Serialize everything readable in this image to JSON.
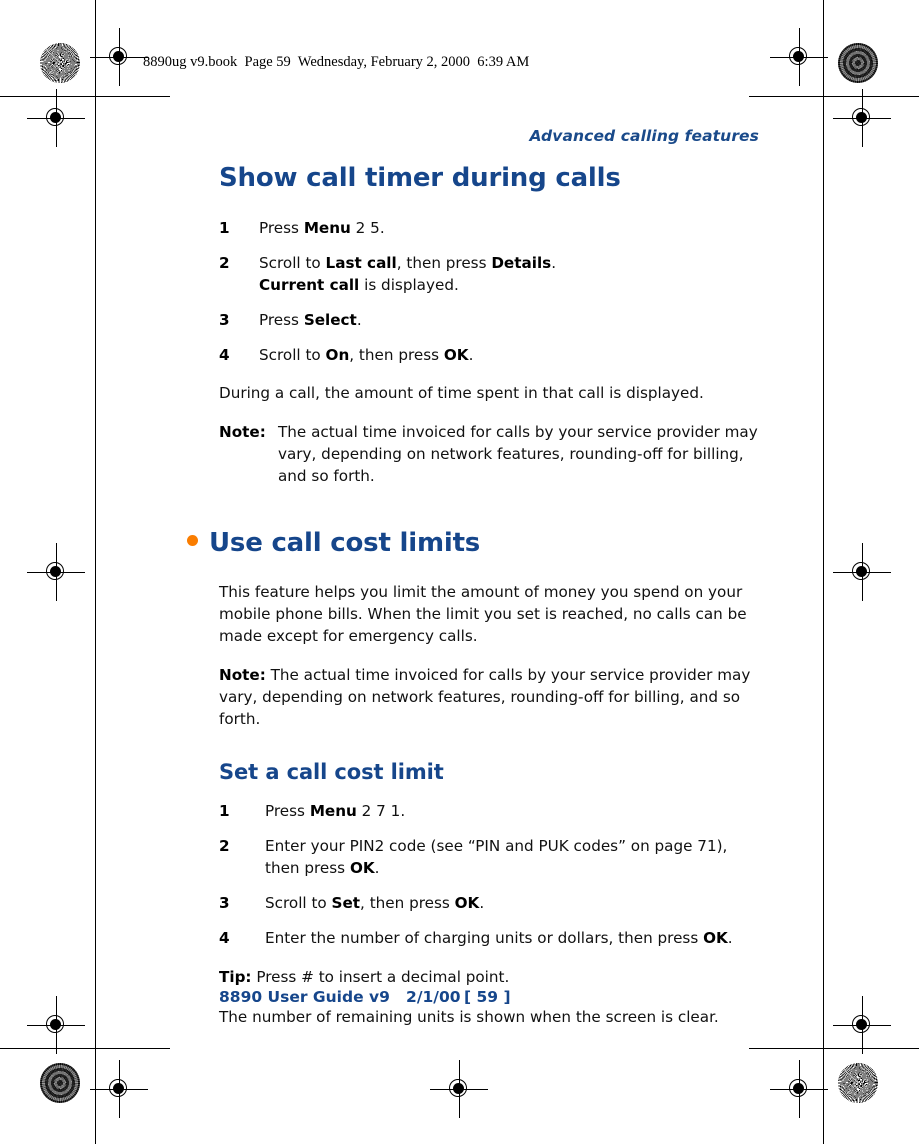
{
  "print_marks": {
    "file_bar": "8890ug v9.book  Page 59  Wednesday, February 2, 2000  6:39 AM"
  },
  "running_head": "Advanced calling features",
  "sections": [
    {
      "heading": "Show call timer during calls",
      "bulleted": false,
      "steps": [
        {
          "num": "1",
          "parts": [
            {
              "t": "Press ",
              "b": false
            },
            {
              "t": "Menu",
              "b": true
            },
            {
              "t": " 2 5.",
              "b": false
            }
          ]
        },
        {
          "num": "2",
          "parts": [
            {
              "t": "Scroll to ",
              "b": false
            },
            {
              "t": "Last call",
              "b": true
            },
            {
              "t": ", then press ",
              "b": false
            },
            {
              "t": "Details",
              "b": true
            },
            {
              "t": ".",
              "b": false
            },
            {
              "t": "\n",
              "b": false
            },
            {
              "t": "Current call",
              "b": true
            },
            {
              "t": " is displayed.",
              "b": false
            }
          ]
        },
        {
          "num": "3",
          "parts": [
            {
              "t": "Press ",
              "b": false
            },
            {
              "t": "Select",
              "b": true
            },
            {
              "t": ".",
              "b": false
            }
          ]
        },
        {
          "num": "4",
          "parts": [
            {
              "t": "Scroll to ",
              "b": false
            },
            {
              "t": "On",
              "b": true
            },
            {
              "t": ", then press ",
              "b": false
            },
            {
              "t": "OK",
              "b": true
            },
            {
              "t": ".",
              "b": false
            }
          ]
        }
      ],
      "after_steps_paragraph": "During a call, the amount of time spent in that call is displayed.",
      "note_hanging": {
        "label": "Note:",
        "text": "The actual time invoiced for calls by your service provider may vary, depending on network features, rounding-off for billing, and so forth."
      }
    },
    {
      "heading": "Use call cost limits",
      "bulleted": true,
      "intro_paragraph": "This feature helps you limit the amount of money you spend on your mobile phone bills. When the limit you set is reached, no calls can be made except for emergency calls.",
      "note_flowing": {
        "label": "Note:",
        "text": "The actual time invoiced for calls by your service provider may vary, depending on network features, rounding-off for billing, and so forth."
      },
      "subheading": "Set a call cost limit",
      "steps": [
        {
          "num": "1",
          "parts": [
            {
              "t": "Press ",
              "b": false
            },
            {
              "t": "Menu",
              "b": true
            },
            {
              "t": " 2 7 1.",
              "b": false
            }
          ]
        },
        {
          "num": "2",
          "parts": [
            {
              "t": "Enter your PIN2 code (see “PIN and PUK codes” on page 71), then press ",
              "b": false
            },
            {
              "t": "OK",
              "b": true
            },
            {
              "t": ".",
              "b": false
            }
          ]
        },
        {
          "num": "3",
          "parts": [
            {
              "t": "Scroll to ",
              "b": false
            },
            {
              "t": "Set",
              "b": true
            },
            {
              "t": ", then press ",
              "b": false
            },
            {
              "t": "OK",
              "b": true
            },
            {
              "t": ".",
              "b": false
            }
          ]
        },
        {
          "num": "4",
          "parts": [
            {
              "t": "Enter the number of charging units or dollars, then press ",
              "b": false
            },
            {
              "t": "OK",
              "b": true
            },
            {
              "t": ".",
              "b": false
            }
          ]
        }
      ],
      "tip": {
        "label": "Tip:",
        "text": "Press # to insert a decimal point."
      },
      "closing_paragraph": "The number of remaining units is shown when the screen is clear."
    }
  ],
  "footer": {
    "guide": "8890 User Guide v9   2/1/00",
    "page_number": "[ 59 ]"
  },
  "colors": {
    "heading_blue": "#16468B",
    "running_head_blue": "#1A4A8A",
    "bullet_orange": "#FA7D00",
    "body_black": "#111111"
  }
}
